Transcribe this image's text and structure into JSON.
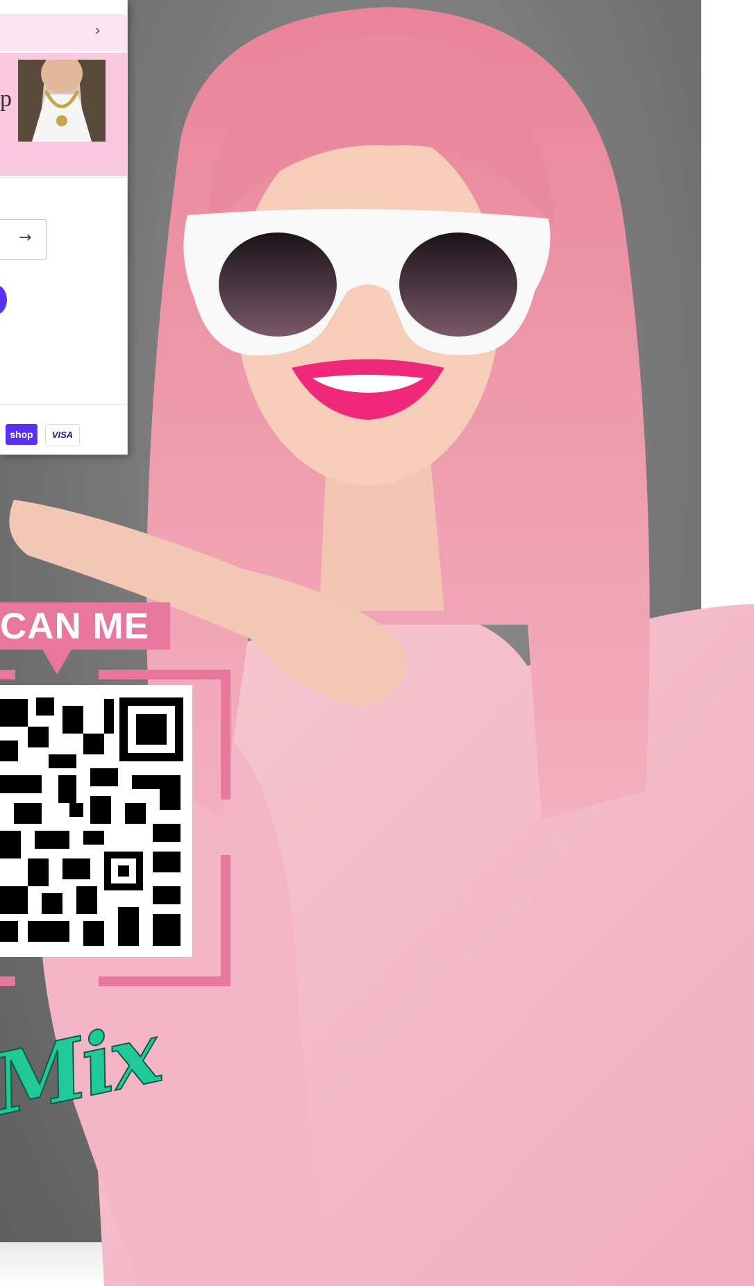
{
  "phone": {
    "chevron": "›",
    "promo_letter": "p",
    "arrow": "→",
    "badges": {
      "shop": "shop",
      "visa": "VISA"
    }
  },
  "scan": {
    "label": "CAN ME"
  },
  "script": {
    "text": "Mix"
  },
  "colors": {
    "accent_pink": "#e8779e",
    "shop_purple": "#5a31f4",
    "script_green": "#20c997",
    "shirt_pink": "#f4b8c8",
    "hair_pink": "#e88aa0"
  }
}
